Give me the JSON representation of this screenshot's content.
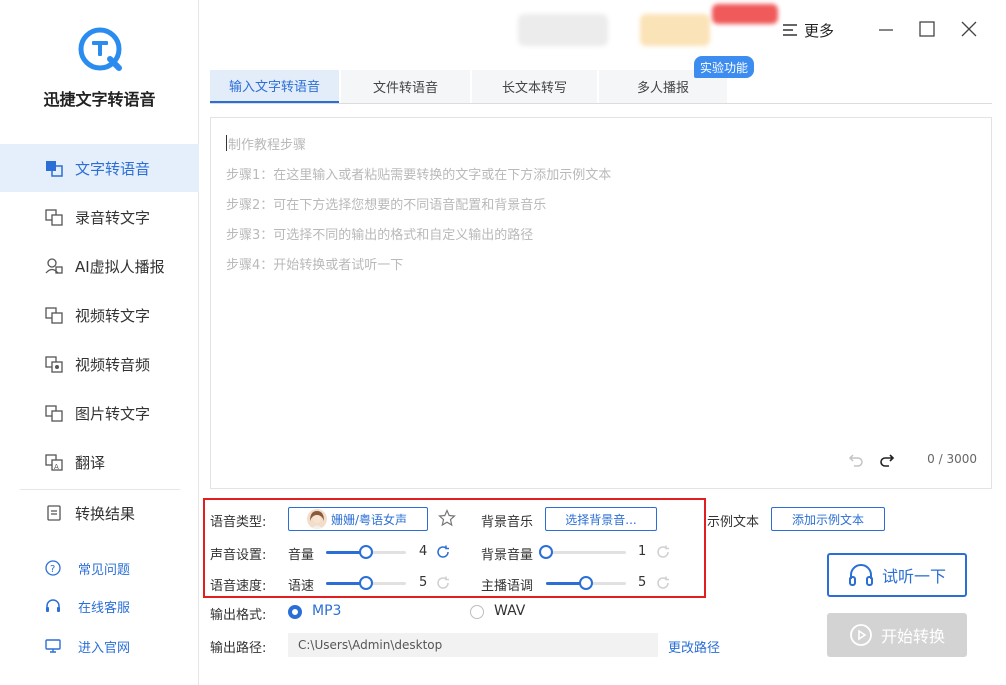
{
  "app": {
    "name": "迅捷文字转语音"
  },
  "sidebar": {
    "items": [
      {
        "label": "文字转语音",
        "icon": "text-to-speech-icon",
        "active": true
      },
      {
        "label": "录音转文字",
        "icon": "recording-to-text-icon"
      },
      {
        "label": "AI虚拟人播报",
        "icon": "ai-avatar-icon"
      },
      {
        "label": "视频转文字",
        "icon": "video-to-text-icon"
      },
      {
        "label": "视频转音频",
        "icon": "video-to-audio-icon"
      },
      {
        "label": "图片转文字",
        "icon": "image-to-text-icon"
      },
      {
        "label": "翻译",
        "icon": "translate-icon"
      },
      {
        "label": "转换结果",
        "icon": "results-icon"
      }
    ],
    "links": [
      {
        "label": "常见问题",
        "icon": "question-icon"
      },
      {
        "label": "在线客服",
        "icon": "headset-icon"
      },
      {
        "label": "进入官网",
        "icon": "monitor-icon"
      }
    ]
  },
  "topbar": {
    "more_label": "更多"
  },
  "tabs": [
    {
      "label": "输入文字转语音",
      "active": true
    },
    {
      "label": "文件转语音"
    },
    {
      "label": "长文本转写"
    },
    {
      "label": "多人播报"
    }
  ],
  "badge": "实验功能",
  "editor": {
    "placeholder_lines": [
      "制作教程步骤",
      "步骤1：在这里输入或者粘贴需要转换的文字或在下方添加示例文本",
      "步骤2：可在下方选择您想要的不同语音配置和背景音乐",
      "步骤3：可选择不同的输出的格式和自定义输出的路径",
      "步骤4：开始转换或者试听一下"
    ],
    "counter": "0 / 3000"
  },
  "settings": {
    "voice_type_label": "语音类型:",
    "voice_name": "姗姗/粤语女声",
    "bg_music_label": "背景音乐",
    "bg_music_button": "选择背景音...",
    "sample_text_label": "示例文本",
    "add_sample_button": "添加示例文本",
    "sound_label": "声音设置:",
    "volume_label": "音量",
    "volume_value": "4",
    "volume_level": 0.5,
    "bg_volume_label": "背景音量",
    "bg_volume_value": "1",
    "bg_volume_level": 0.0,
    "speed_label": "语音速度:",
    "speed_sub_label": "语速",
    "speed_value": "5",
    "speed_level": 0.5,
    "tone_label": "主播语调",
    "tone_value": "5",
    "tone_level": 0.5
  },
  "output": {
    "format_label": "输出格式:",
    "formats": [
      "MP3",
      "WAV"
    ],
    "selected_format": "MP3",
    "path_label": "输出路径:",
    "path_value": "C:\\Users\\Admin\\desktop",
    "change_path": "更改路径"
  },
  "actions": {
    "listen": "试听一下",
    "start": "开始转换"
  },
  "colors": {
    "accent": "#2b6fd6",
    "highlight_border": "#e02020",
    "active_bg": "#e5eefb"
  }
}
